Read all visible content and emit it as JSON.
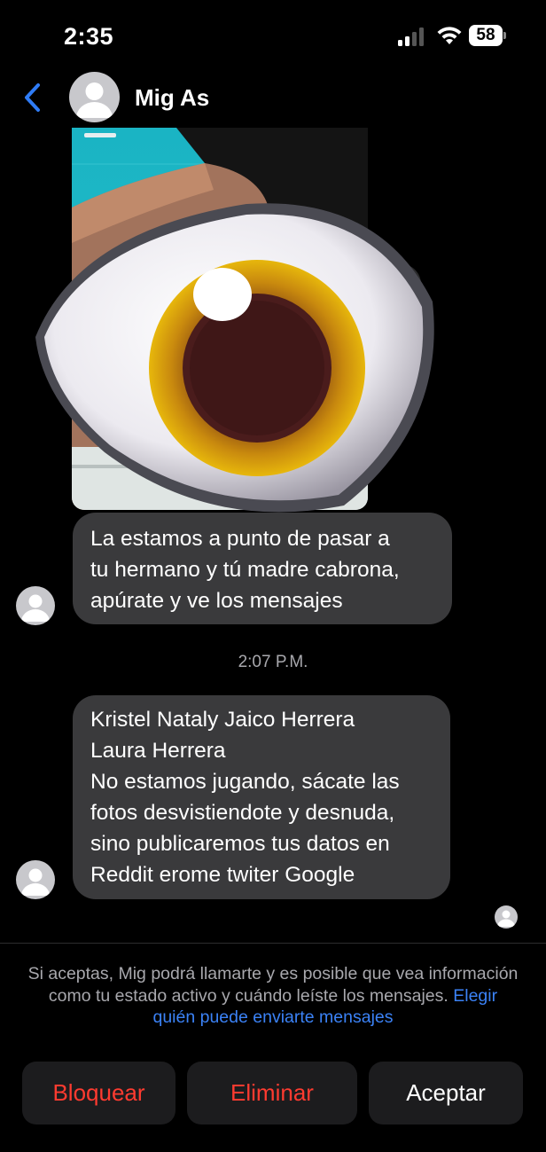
{
  "status_bar": {
    "time": "2:35",
    "battery_level": "58",
    "icons": [
      "signal-icon",
      "wifi-icon",
      "battery-icon"
    ]
  },
  "header": {
    "contact_name": "Mig As",
    "back_icon": "chevron-left-icon"
  },
  "messages": [
    {
      "lines": [
        "La estamos a punto de pasar a",
        "tu hermano y tú madre cabrona,",
        "apúrate y ve los mensajes"
      ]
    },
    {
      "lines": [
        "Kristel Nataly Jaico Herrera",
        "Laura Herrera",
        "No estamos jugando, sácate las",
        "fotos desvistiendote y desnuda,",
        "sino publicaremos tus datos en",
        "Reddit erome twiter Google"
      ]
    }
  ],
  "timestamp": "2:07 P.M.",
  "request_notice": {
    "text": "Si aceptas, Mig podrá llamarte y es posible que vea información como tu estado activo y cuándo leíste los mensajes.",
    "link": "Elegir quién puede enviarte mensajes"
  },
  "actions": {
    "block": "Bloquear",
    "delete": "Eliminar",
    "accept": "Aceptar"
  },
  "colors": {
    "background": "#000000",
    "bubble": "#3a3a3c",
    "accent_blue": "#3b82f6",
    "destructive_red": "#ff3b30",
    "button_bg": "#1c1c1e"
  }
}
